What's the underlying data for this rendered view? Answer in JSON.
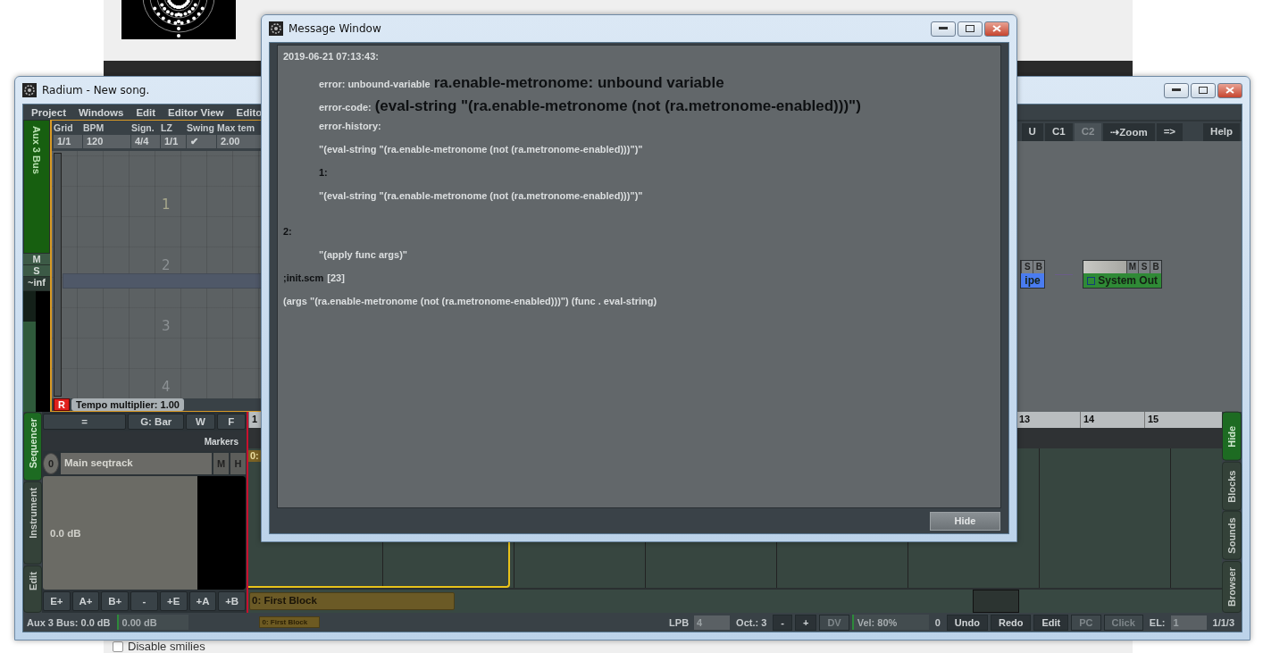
{
  "background_page": {
    "checkbox": {
      "label": "Disable smilies",
      "checked": false
    }
  },
  "main_window": {
    "title": "Radium - New song.",
    "menu": [
      "Project",
      "Windows",
      "Edit",
      "Editor View",
      "Edito"
    ],
    "aux_strip": {
      "name": "Aux 3 Bus",
      "mute": "M",
      "solo": "S",
      "volume": "~inf",
      "meter": {
        "level": 0.75
      }
    },
    "editor_header": [
      {
        "label": "Grid",
        "value": "1/1"
      },
      {
        "label": "BPM",
        "value": "120"
      },
      {
        "label": "Sign.",
        "value": "4/4"
      },
      {
        "label": "LZ",
        "value": "1/1"
      },
      {
        "label": "Swing",
        "value": "✔"
      },
      {
        "label": "Max tem",
        "value": "2.00"
      }
    ],
    "line_numbers": [
      "1",
      "2",
      "3",
      "4"
    ],
    "tempo": {
      "record": "R",
      "label": "Tempo multiplier: 1.00"
    },
    "mixer": {
      "buttons": [
        {
          "label": "U",
          "disabled": false
        },
        {
          "label": "C1",
          "disabled": false
        },
        {
          "label": "C2",
          "disabled": true
        },
        {
          "label": "⇢Zoom",
          "disabled": false
        },
        {
          "label": "=>",
          "disabled": false
        }
      ],
      "help": "Help",
      "nodes": [
        {
          "name": "ipe",
          "color": "#4a7cf0",
          "buttons": [
            "S",
            "B"
          ]
        },
        {
          "name": "System Out",
          "color": "#2f8a36",
          "buttons": [
            "M",
            "S",
            "B"
          ]
        }
      ]
    },
    "sequencer": {
      "tabs": [
        {
          "label": "Sequencer",
          "selected": true
        },
        {
          "label": "Instrument",
          "selected": false
        },
        {
          "label": "Edit",
          "selected": false
        }
      ],
      "toolbar": [
        "=",
        "G: Bar",
        "W",
        "F"
      ],
      "markers": "Markers",
      "track": {
        "number": "0",
        "name": "Main seqtrack",
        "buttons": [
          "M",
          "H"
        ],
        "volume": "0.0 dB"
      },
      "block_buttons": [
        "E+",
        "A+",
        "B+",
        "-",
        "+E",
        "+A",
        "+B"
      ],
      "ruler": [
        "1",
        "13",
        "14",
        "15"
      ],
      "lane_block": "0:",
      "block_bar": "0: First Block"
    },
    "right_tabs": [
      {
        "label": "Hide",
        "selected": true
      },
      {
        "label": "Blocks",
        "selected": false
      },
      {
        "label": "Sounds",
        "selected": false
      },
      {
        "label": "Browser",
        "selected": false
      }
    ],
    "status_bar": {
      "left": [
        {
          "kind": "text",
          "text": "Aux 3 Bus: 0.0 dB"
        },
        {
          "kind": "meter",
          "text": "0.00 dB"
        },
        {
          "kind": "clip",
          "text": "0: First Block"
        }
      ],
      "right": [
        {
          "kind": "field",
          "label": "LPB",
          "value": "4"
        },
        {
          "kind": "text",
          "text": "Oct.: 3"
        },
        {
          "kind": "button",
          "text": "-",
          "disabled": false
        },
        {
          "kind": "button",
          "text": "+",
          "disabled": false
        },
        {
          "kind": "button",
          "text": "DV",
          "disabled": true
        },
        {
          "kind": "meter",
          "text": "Vel: 80%"
        },
        {
          "kind": "text",
          "text": "0"
        },
        {
          "kind": "button",
          "text": "Undo",
          "disabled": false
        },
        {
          "kind": "button",
          "text": "Redo",
          "disabled": false
        },
        {
          "kind": "button",
          "text": "Edit",
          "disabled": false
        },
        {
          "kind": "button",
          "text": "PC",
          "disabled": true
        },
        {
          "kind": "button",
          "text": "Click",
          "disabled": true
        },
        {
          "kind": "field",
          "label": "EL:",
          "value": "1"
        },
        {
          "kind": "text",
          "text": "1/1/3"
        }
      ]
    }
  },
  "message_window": {
    "title": "Message Window",
    "lines": [
      {
        "kind": "flush",
        "parts": [
          {
            "large": false,
            "dark": false,
            "text": "2019-06-21 07:13:43:"
          }
        ]
      },
      {
        "kind": "indent",
        "parts": [
          {
            "large": false,
            "dark": false,
            "text": "error: unbound-variable"
          },
          {
            "large": true,
            "dark": true,
            "text": "ra.enable-metronome: unbound variable"
          }
        ]
      },
      {
        "kind": "indent",
        "parts": [
          {
            "large": false,
            "dark": false,
            "text": "error-code:"
          },
          {
            "large": true,
            "dark": true,
            "text": "(eval-string \"(ra.enable-metronome (not (ra.metronome-enabled)))\")"
          }
        ]
      },
      {
        "kind": "indent",
        "parts": [
          {
            "large": false,
            "dark": false,
            "text": "error-history:"
          }
        ]
      },
      {
        "kind": "indent",
        "parts": [
          {
            "large": false,
            "dark": false,
            "text": "\"(eval-string \"(ra.enable-metronome (not (ra.metronome-enabled)))\")\""
          }
        ]
      },
      {
        "kind": "indent",
        "parts": [
          {
            "large": false,
            "dark": true,
            "text": "1:"
          }
        ]
      },
      {
        "kind": "indent",
        "parts": [
          {
            "large": false,
            "dark": false,
            "text": "\"(eval-string \"(ra.enable-metronome (not (ra.metronome-enabled)))\")\""
          }
        ]
      },
      {
        "kind": "gap",
        "parts": [
          {
            "large": false,
            "dark": true,
            "text": "2:"
          }
        ]
      },
      {
        "kind": "indent",
        "parts": [
          {
            "large": false,
            "dark": false,
            "text": "\"(apply func args)\""
          }
        ]
      },
      {
        "kind": "flush",
        "parts": [
          {
            "large": false,
            "dark": true,
            "text": ";init.scm"
          },
          {
            "large": false,
            "dark": false,
            "text": "[23]"
          }
        ]
      },
      {
        "kind": "flush",
        "parts": [
          {
            "large": false,
            "dark": false,
            "text": "(args \"(ra.enable-metronome (not (ra.metronome-enabled)))\") (func . eval-string)"
          }
        ]
      }
    ],
    "button": "Hide"
  }
}
